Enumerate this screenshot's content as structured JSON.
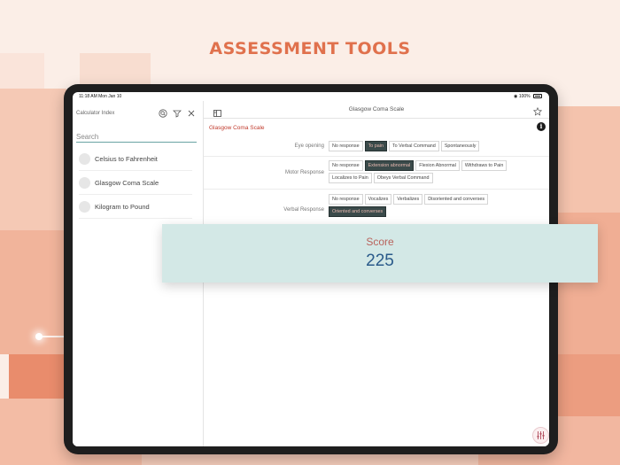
{
  "headline": "ASSESSMENT TOOLS",
  "status_bar": {
    "time": "11:18 AM  Mon Jan 10",
    "battery": "100%"
  },
  "sidebar": {
    "title": "Calculator Index",
    "search_placeholder": "Search",
    "icons": [
      "search-icon",
      "filter-icon",
      "close-icon"
    ],
    "items": [
      {
        "label": "Celsius to Fahrenheit"
      },
      {
        "label": "Glasgow Coma Scale"
      },
      {
        "label": "Kilogram to Pound"
      }
    ]
  },
  "nav": {
    "title": "Glasgow Coma Scale",
    "left_icon": "sidebar-toggle-icon",
    "right_icon": "star-icon"
  },
  "calculator": {
    "title": "Glasgow Coma Scale",
    "info_label": "i",
    "rows": [
      {
        "label": "Eye opening",
        "options": [
          "No response",
          "To pain",
          "To Verbal Command",
          "Spontaneously"
        ],
        "selected": 1
      },
      {
        "label": "Motor Response",
        "options": [
          "No response",
          "Extension abnormal",
          "Flexion Abnormal",
          "Withdraws to Pain",
          "Localizes to Pain",
          "Obeys Verbal Command"
        ],
        "selected": 1
      },
      {
        "label": "Verbal Response",
        "options": [
          "No response",
          "Vocalizes",
          "Verbalizes",
          "Disoriented and converses",
          "Oriented and converses"
        ],
        "selected": 4
      }
    ]
  },
  "score": {
    "label": "Score",
    "value": "225"
  },
  "colors": {
    "accent": "#e0714d",
    "selected_bg": "#3a4a4a",
    "score_bg": "#d3e8e6",
    "score_value": "#2a5a8a"
  }
}
